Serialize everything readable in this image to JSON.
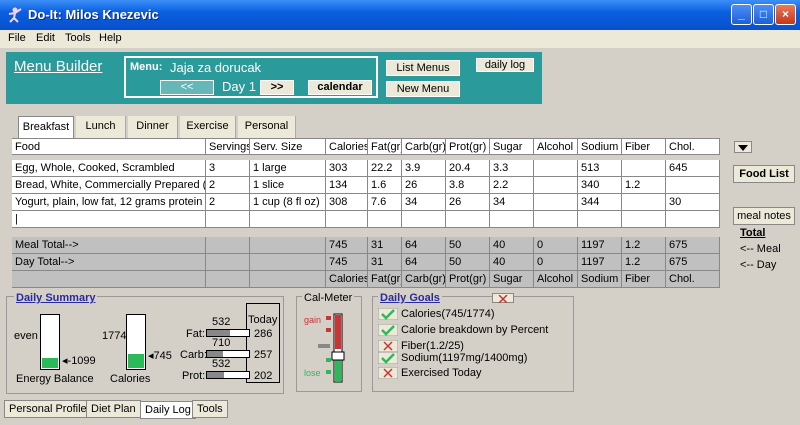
{
  "window": {
    "title": "Do-It: Milos Knezevic"
  },
  "menubar": [
    "File",
    "Edit",
    "Tools",
    "Help"
  ],
  "builder": {
    "title": "Menu Builder",
    "menu_label": "Menu:",
    "menu_name": "Jaja za dorucak",
    "prev": "<<",
    "day": "Day 1",
    "next": ">>",
    "calendar": "calendar",
    "list_menus": "List Menus",
    "new_menu": "New Menu",
    "daily_log": "daily log"
  },
  "meal_tabs": [
    "Breakfast",
    "Lunch",
    "Dinner",
    "Exercise",
    "Personal"
  ],
  "table": {
    "columns": [
      "Food",
      "Servings",
      "Serv. Size",
      "Calories",
      "Fat(gr)",
      "Carb(gr)",
      "Prot(gr)",
      "Sugar",
      "Alcohol",
      "Sodium",
      "Fiber",
      "Chol."
    ],
    "rows": [
      [
        "Egg, Whole, Cooked, Scrambled",
        "3",
        "1 large",
        "303",
        "22.2",
        "3.9",
        "20.4",
        "3.3",
        "",
        "513",
        "",
        "645"
      ],
      [
        "Bread, White, Commercially Prepared (Incl",
        "2",
        "1 slice",
        "134",
        "1.6",
        "26",
        "3.8",
        "2.2",
        "",
        "340",
        "1.2",
        ""
      ],
      [
        "Yogurt, plain, low fat, 12 grams protein per",
        "2",
        "1 cup (8 fl oz)",
        "308",
        "7.6",
        "34",
        "26",
        "34",
        "",
        "344",
        "",
        "30"
      ],
      [
        "|",
        "",
        "",
        "",
        "",
        "",
        "",
        "",
        "",
        "",
        "",
        ""
      ]
    ],
    "meal_total": [
      "Meal Total-->",
      "",
      "",
      "745",
      "31",
      "64",
      "50",
      "40",
      "0",
      "1197",
      "1.2",
      "675"
    ],
    "day_total": [
      "Day Total-->",
      "",
      "",
      "745",
      "31",
      "64",
      "50",
      "40",
      "0",
      "1197",
      "1.2",
      "675"
    ],
    "footer": [
      "",
      "",
      "",
      "Calories",
      "Fat(gr)",
      "Carb(gr)",
      "Prot(gr)",
      "Sugar",
      "Alcohol",
      "Sodium",
      "Fiber",
      "Chol."
    ]
  },
  "side": {
    "food_list": "Food List",
    "meal_notes": "meal notes",
    "total": "Total",
    "meal": "<-- Meal",
    "day": "<-- Day"
  },
  "daily_summary": {
    "title": "Daily Summary",
    "even": "even",
    "energy_value": "-1099",
    "energy_label": "Energy Balance",
    "cal_target": "1774",
    "cal_value": "745",
    "cal_label": "Calories",
    "today": "Today",
    "macros": [
      {
        "label": "Fat:",
        "target": "532",
        "today": "286"
      },
      {
        "label": "Carb:",
        "target": "710",
        "today": "257"
      },
      {
        "label": "Prot:",
        "target": "532",
        "today": "202"
      }
    ]
  },
  "calmeter": {
    "title": "Cal-Meter",
    "gain": "gain",
    "lose": "lose"
  },
  "daily_goals": {
    "title": "Daily Goals",
    "items": [
      {
        "text": "Calories(745/1774)",
        "met": true
      },
      {
        "text": "Calorie breakdown by Percent",
        "met": true
      },
      {
        "text": "Fiber(1.2/25)",
        "met": false
      },
      {
        "text": "Sodium(1197mg/1400mg)",
        "met": true
      },
      {
        "text": "Exercised Today",
        "met": false
      }
    ]
  },
  "bottom_tabs": [
    "Personal Profile",
    "Diet Plan",
    "Daily Log",
    "Tools"
  ],
  "colors": {
    "teal": "#2a9a9a",
    "green": "#2aba5a",
    "red": "#cc3333",
    "goals_title": "#2a2aa0"
  }
}
